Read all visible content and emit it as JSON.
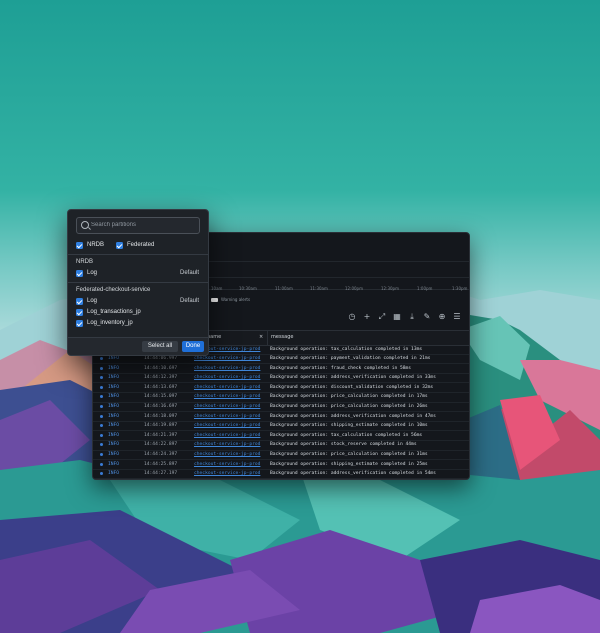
{
  "log_window": {
    "timeline_ticks": [
      "10am",
      "10:30am",
      "11:00am",
      "11:30am",
      "12:00pm",
      "12:30pm",
      "1:00pm",
      "1:30pm"
    ],
    "legend": "Warning alerts",
    "columns": {
      "name": "name",
      "close": "×",
      "message": "message"
    },
    "rows": [
      {
        "level": "INFO",
        "time": "14:44:09.597",
        "service": "checkout-service-jp-prod",
        "message": "Background operation: tax_calculation completed in 13ms"
      },
      {
        "level": "INFO",
        "time": "14:44:06.997",
        "service": "checkout-service-jp-prod",
        "message": "Background operation: payment_validation completed in 21ms"
      },
      {
        "level": "INFO",
        "time": "14:44:10.697",
        "service": "checkout-service-jp-prod",
        "message": "Background operation: fraud_check completed in 58ms"
      },
      {
        "level": "INFO",
        "time": "14:44:12.397",
        "service": "checkout-service-jp-prod",
        "message": "Background operation: address_verification completed in 33ms"
      },
      {
        "level": "INFO",
        "time": "14:44:13.697",
        "service": "checkout-service-jp-prod",
        "message": "Background operation: discount_validation completed in 32ms"
      },
      {
        "level": "INFO",
        "time": "14:44:15.097",
        "service": "checkout-service-jp-prod",
        "message": "Background operation: price_calculation completed in 17ms"
      },
      {
        "level": "INFO",
        "time": "14:44:16.697",
        "service": "checkout-service-jp-prod",
        "message": "Background operation: price_calculation completed in 26ms"
      },
      {
        "level": "INFO",
        "time": "14:44:18.097",
        "service": "checkout-service-jp-prod",
        "message": "Background operation: address_verification completed in 47ms"
      },
      {
        "level": "INFO",
        "time": "14:44:19.897",
        "service": "checkout-service-jp-prod",
        "message": "Background operation: shipping_estimate completed in 10ms"
      },
      {
        "level": "INFO",
        "time": "14:44:21.397",
        "service": "checkout-service-jp-prod",
        "message": "Background operation: tax_calculation completed in 56ms"
      },
      {
        "level": "INFO",
        "time": "14:44:22.897",
        "service": "checkout-service-jp-prod",
        "message": "Background operation: stock_reserve completed in 44ms"
      },
      {
        "level": "INFO",
        "time": "14:44:24.397",
        "service": "checkout-service-jp-prod",
        "message": "Background operation: price_calculation completed in 31ms"
      },
      {
        "level": "INFO",
        "time": "14:44:25.897",
        "service": "checkout-service-jp-prod",
        "message": "Background operation: shipping_estimate completed in 25ms"
      },
      {
        "level": "INFO",
        "time": "14:44:27.197",
        "service": "checkout-service-jp-prod",
        "message": "Background operation: address_verification completed in 54ms"
      }
    ]
  },
  "partition_popup": {
    "search_placeholder": "Search partitions",
    "filters": [
      {
        "label": "NRDB",
        "checked": true
      },
      {
        "label": "Federated",
        "checked": true
      }
    ],
    "sections": [
      {
        "title": "NRDB",
        "items": [
          {
            "label": "Log",
            "badge": "Default",
            "checked": true
          }
        ]
      },
      {
        "title": "Federated-checkout-service",
        "items": [
          {
            "label": "Log",
            "badge": "Default",
            "checked": true
          },
          {
            "label": "Log_transactions_jp",
            "badge": "",
            "checked": true
          },
          {
            "label": "Log_inventory_jp",
            "badge": "",
            "checked": true
          }
        ]
      }
    ],
    "select_all_label": "Select all",
    "done_label": "Done"
  },
  "colors": {
    "accent": "#2f7fe1",
    "window_bg": "#14171c",
    "popup_bg": "#1e2227",
    "info_blue": "#4e8fe0"
  }
}
